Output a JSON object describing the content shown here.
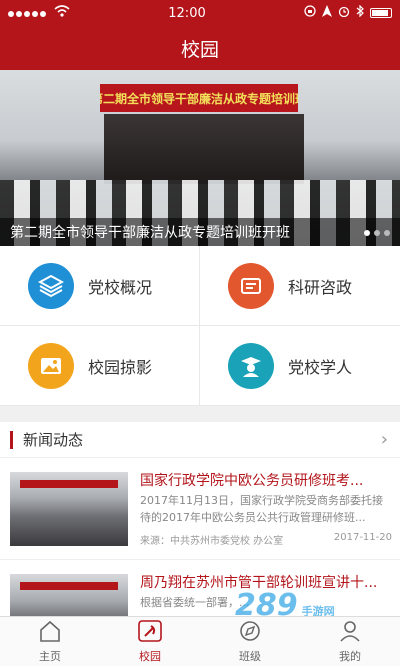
{
  "status": {
    "time": "12:00"
  },
  "header": {
    "title": "校园"
  },
  "banner": {
    "sign_text": "第二期全市领导干部廉洁从政专题培训班",
    "caption": "第二期全市领导干部廉洁从政专题培训班开班"
  },
  "grid": [
    {
      "label": "党校概况",
      "color": "#1f8fd6",
      "icon": "layers-icon"
    },
    {
      "label": "科研咨政",
      "color": "#e2572d",
      "icon": "book-icon"
    },
    {
      "label": "校园掠影",
      "color": "#f2a51c",
      "icon": "image-icon"
    },
    {
      "label": "党校学人",
      "color": "#1aa3b8",
      "icon": "scholar-icon"
    }
  ],
  "news_section": {
    "title": "新闻动态"
  },
  "news": [
    {
      "title": "国家行政学院中欧公务员研修班考...",
      "summary": "2017年11月13日，国家行政学院受商务部委托接待的2017年中欧公务员公共行政管理研修班...",
      "source": "来源：中共苏州市委党校 办公室",
      "date": "2017-11-20"
    },
    {
      "title": "周乃翔在苏州市管干部轮训班宣讲十...",
      "summary": "根据省委统一部署，...",
      "source": "",
      "date": ""
    }
  ],
  "tabs": [
    {
      "label": "主页",
      "icon": "home-icon"
    },
    {
      "label": "校园",
      "icon": "party-emblem-icon"
    },
    {
      "label": "班级",
      "icon": "compass-icon"
    },
    {
      "label": "我的",
      "icon": "user-icon"
    }
  ],
  "watermark": {
    "text": "289",
    "sub": "手游网"
  }
}
